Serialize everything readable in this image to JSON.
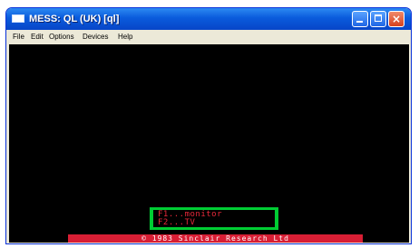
{
  "window": {
    "title": "MESS: QL (UK) [ql]",
    "controls": {
      "minimize": "minimize-icon",
      "maximize": "maximize-icon",
      "close": "×"
    }
  },
  "menu": [
    "File",
    "Edit",
    "Options",
    "Devices",
    "Help"
  ],
  "screen": {
    "options": [
      "F1...monitor",
      "F2...TV"
    ],
    "copyright": "© 1983 Sinclair Research Ltd"
  },
  "colors": {
    "titlebar": "#0a5bdc",
    "screen": "#000000",
    "box": "#00cc33",
    "text": "#e8283a",
    "banner": "#d81e34"
  }
}
